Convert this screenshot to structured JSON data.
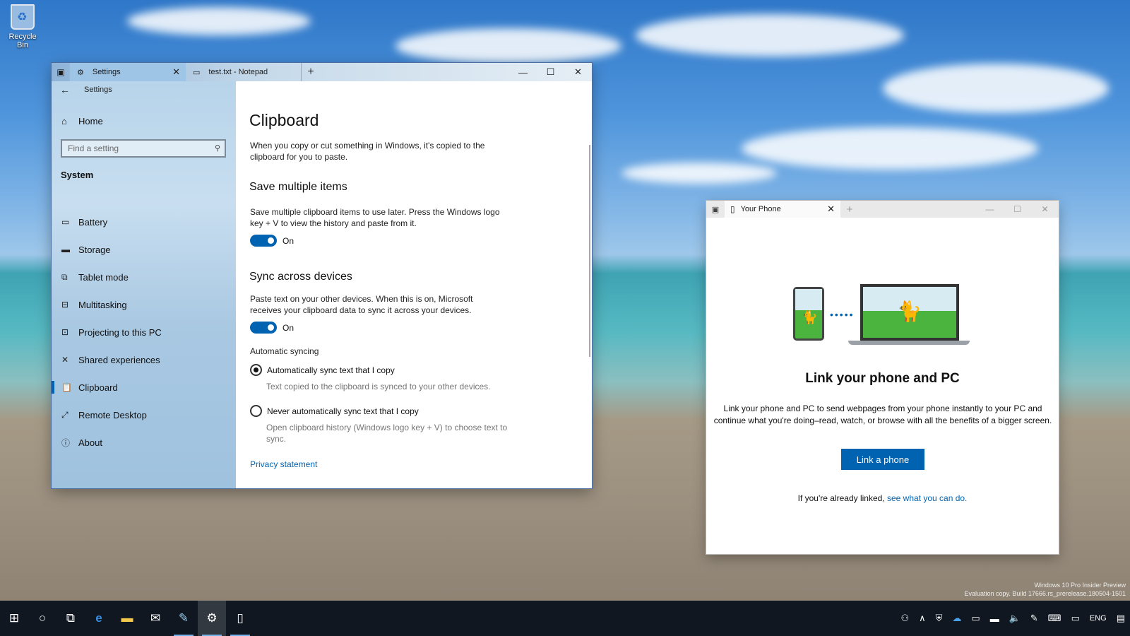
{
  "desktop": {
    "recycle_bin_label": "Recycle Bin",
    "watermark_line1": "Windows 10 Pro Insider Preview",
    "watermark_line2": "Evaluation copy. Build 17666.rs_prerelease.180504-1501"
  },
  "settings_window": {
    "tabs": [
      {
        "label": "Settings",
        "icon": "gear-icon",
        "active": true
      },
      {
        "label": "test.txt - Notepad",
        "icon": "notepad-icon",
        "active": false
      }
    ],
    "breadcrumb": "Settings",
    "nav": {
      "home_label": "Home",
      "search_placeholder": "Find a setting",
      "section_label": "System",
      "items": [
        {
          "label": "Battery",
          "icon": "battery-icon"
        },
        {
          "label": "Storage",
          "icon": "storage-icon"
        },
        {
          "label": "Tablet mode",
          "icon": "tablet-mode-icon"
        },
        {
          "label": "Multitasking",
          "icon": "multitasking-icon"
        },
        {
          "label": "Projecting to this PC",
          "icon": "projecting-icon"
        },
        {
          "label": "Shared experiences",
          "icon": "shared-experiences-icon"
        },
        {
          "label": "Clipboard",
          "icon": "clipboard-icon",
          "selected": true
        },
        {
          "label": "Remote Desktop",
          "icon": "remote-desktop-icon"
        },
        {
          "label": "About",
          "icon": "info-icon"
        }
      ]
    },
    "content": {
      "title": "Clipboard",
      "intro": "When you copy or cut something in Windows, it's copied to the clipboard for you to paste.",
      "save_multiple": {
        "heading": "Save multiple items",
        "description": "Save multiple clipboard items to use later. Press the Windows logo key + V to view the history and paste from it.",
        "toggle_state": "On"
      },
      "sync": {
        "heading": "Sync across devices",
        "description": "Paste text on your other devices. When this is on, Microsoft receives your clipboard data to sync it across your devices.",
        "toggle_state": "On"
      },
      "automatic_syncing": {
        "label": "Automatic syncing",
        "option1": "Automatically sync text that I copy",
        "option1_sub": "Text copied to the clipboard is synced to your other devices.",
        "option2": "Never automatically sync text that I copy",
        "option2_sub": "Open clipboard history (Windows logo key + V) to choose text to sync.",
        "selected_option": 1
      },
      "privacy_link": "Privacy statement"
    }
  },
  "phone_window": {
    "tab_label": "Your Phone",
    "heading": "Link your phone and PC",
    "description": "Link your phone and PC to send webpages from your phone instantly to your PC and continue what you're doing–read, watch, or browse with all the benefits of a bigger screen.",
    "button_label": "Link a phone",
    "linked_prefix": "If you're already linked, ",
    "linked_link": "see what you can do."
  },
  "taskbar": {
    "language": "ENG",
    "pinned": [
      "start-icon",
      "cortana-icon",
      "task-view-icon",
      "edge-icon",
      "file-explorer-icon",
      "mail-icon",
      "notepad-icon",
      "settings-icon",
      "your-phone-icon"
    ]
  },
  "colors": {
    "accent": "#0063b1",
    "nav_background": "#b7d4ea",
    "taskbar": "#101720"
  }
}
